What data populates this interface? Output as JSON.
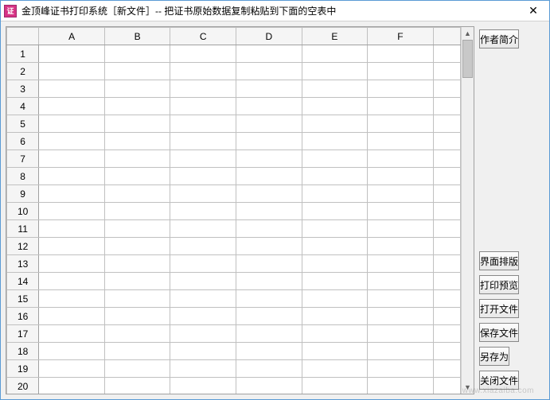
{
  "titlebar": {
    "icon_label": "证",
    "title": "金顶峰证书打印系统［新文件］-- 把证书原始数据复制粘贴到下面的空表中",
    "close_symbol": "✕"
  },
  "grid": {
    "columns": [
      "A",
      "B",
      "C",
      "D",
      "E",
      "F"
    ],
    "partial_last_column": true,
    "rows": [
      1,
      2,
      3,
      4,
      5,
      6,
      7,
      8,
      9,
      10,
      11,
      12,
      13,
      14,
      15,
      16,
      17,
      18,
      19,
      20
    ],
    "cells": {}
  },
  "sidebar": {
    "top_buttons": [
      {
        "name": "author-info-button",
        "label": "作者简介"
      }
    ],
    "bottom_buttons": [
      {
        "name": "layout-button",
        "label": "界面排版"
      },
      {
        "name": "print-preview-button",
        "label": "打印预览"
      },
      {
        "name": "open-file-button",
        "label": "打开文件"
      },
      {
        "name": "save-file-button",
        "label": "保存文件"
      },
      {
        "name": "save-as-button",
        "label": "另存为"
      },
      {
        "name": "close-file-button",
        "label": "关闭文件"
      }
    ]
  },
  "watermark": "www.xiazaiba.com"
}
